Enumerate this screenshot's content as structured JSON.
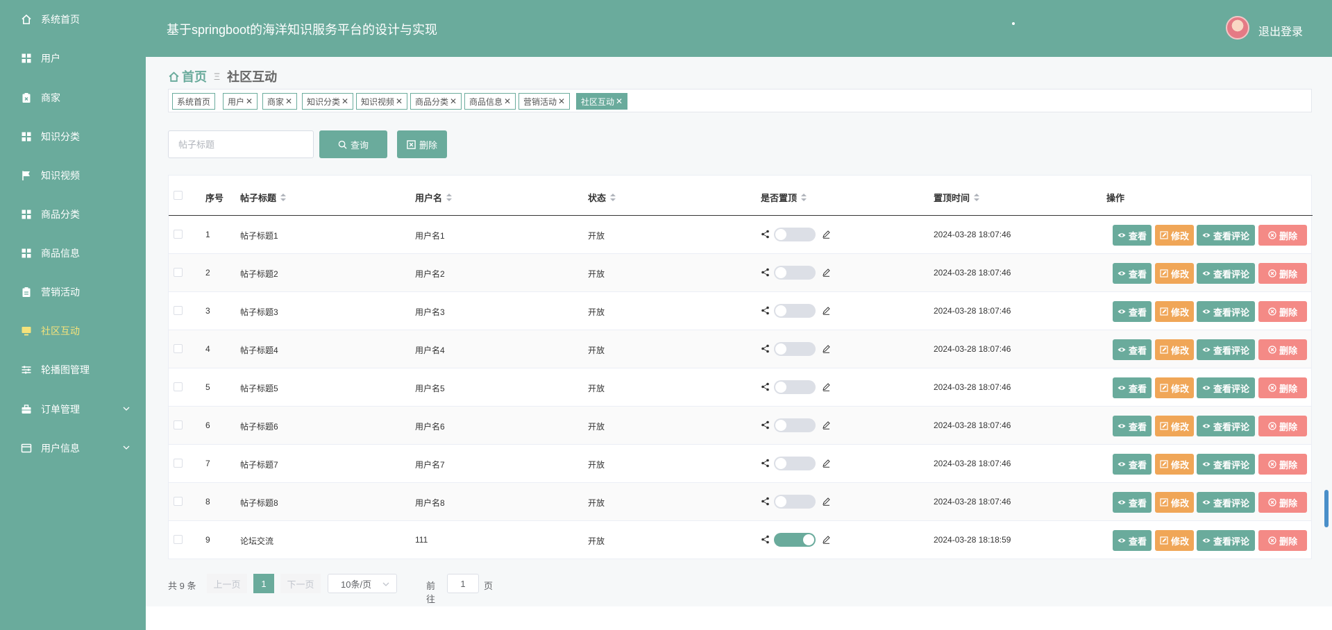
{
  "sidebar": {
    "items": [
      {
        "label": "系统首页",
        "icon": "home-icon",
        "active": false
      },
      {
        "label": "用户",
        "icon": "grid-icon",
        "active": false
      },
      {
        "label": "商家",
        "icon": "clipboard-x-icon",
        "active": false
      },
      {
        "label": "知识分类",
        "icon": "grid-icon",
        "active": false
      },
      {
        "label": "知识视频",
        "icon": "flag-icon",
        "active": false
      },
      {
        "label": "商品分类",
        "icon": "grid-icon",
        "active": false
      },
      {
        "label": "商品信息",
        "icon": "grid-icon",
        "active": false
      },
      {
        "label": "营销活动",
        "icon": "clipboard-icon",
        "active": false
      },
      {
        "label": "社区互动",
        "icon": "monitor-icon",
        "active": true
      },
      {
        "label": "轮播图管理",
        "icon": "sliders-icon",
        "active": false
      },
      {
        "label": "订单管理",
        "icon": "briefcase-icon",
        "active": false,
        "expandable": true
      },
      {
        "label": "用户信息",
        "icon": "card-icon",
        "active": false,
        "expandable": true
      }
    ]
  },
  "header": {
    "title": "基于springboot的海洋知识服务平台的设计与实现",
    "logout_label": "退出登录"
  },
  "breadcrumb": {
    "home": "首页",
    "separator": "Ξ",
    "current": "社区互动"
  },
  "tags": [
    {
      "label": "系统首页",
      "closable": false,
      "active": false
    },
    {
      "label": "用户",
      "closable": true,
      "active": false
    },
    {
      "label": "商家",
      "closable": true,
      "active": false
    },
    {
      "label": "知识分类",
      "closable": true,
      "active": false
    },
    {
      "label": "知识视频",
      "closable": true,
      "active": false
    },
    {
      "label": "商品分类",
      "closable": true,
      "active": false
    },
    {
      "label": "商品信息",
      "closable": true,
      "active": false
    },
    {
      "label": "营销活动",
      "closable": true,
      "active": false
    },
    {
      "label": "社区互动",
      "closable": true,
      "active": true
    }
  ],
  "tag_close_glyph": "✕",
  "search": {
    "placeholder": "帖子标题",
    "query_label": "查询",
    "delete_label": "删除"
  },
  "table": {
    "columns": {
      "index": "序号",
      "title": "帖子标题",
      "username": "用户名",
      "status": "状态",
      "pinned": "是否置顶",
      "pin_time": "置顶时间",
      "actions": "操作"
    },
    "rows": [
      {
        "index": "1",
        "title": "帖子标题1",
        "username": "用户名1",
        "status": "开放",
        "pinned": false,
        "pin_time": "2024-03-28 18:07:46"
      },
      {
        "index": "2",
        "title": "帖子标题2",
        "username": "用户名2",
        "status": "开放",
        "pinned": false,
        "pin_time": "2024-03-28 18:07:46"
      },
      {
        "index": "3",
        "title": "帖子标题3",
        "username": "用户名3",
        "status": "开放",
        "pinned": false,
        "pin_time": "2024-03-28 18:07:46"
      },
      {
        "index": "4",
        "title": "帖子标题4",
        "username": "用户名4",
        "status": "开放",
        "pinned": false,
        "pin_time": "2024-03-28 18:07:46"
      },
      {
        "index": "5",
        "title": "帖子标题5",
        "username": "用户名5",
        "status": "开放",
        "pinned": false,
        "pin_time": "2024-03-28 18:07:46"
      },
      {
        "index": "6",
        "title": "帖子标题6",
        "username": "用户名6",
        "status": "开放",
        "pinned": false,
        "pin_time": "2024-03-28 18:07:46"
      },
      {
        "index": "7",
        "title": "帖子标题7",
        "username": "用户名7",
        "status": "开放",
        "pinned": false,
        "pin_time": "2024-03-28 18:07:46"
      },
      {
        "index": "8",
        "title": "帖子标题8",
        "username": "用户名8",
        "status": "开放",
        "pinned": false,
        "pin_time": "2024-03-28 18:07:46"
      },
      {
        "index": "9",
        "title": "论坛交流",
        "username": "111",
        "status": "开放",
        "pinned": true,
        "pin_time": "2024-03-28 18:18:59"
      }
    ],
    "action_labels": {
      "view": "查看",
      "edit": "修改",
      "comments": "查看评论",
      "delete": "删除"
    }
  },
  "pagination": {
    "total_text": "共 9 条",
    "prev_label": "上一页",
    "current_page": "1",
    "next_label": "下一页",
    "page_size": "10条/页",
    "goto_label": "前往",
    "goto_value": "1",
    "page_suffix": "页"
  },
  "colors": {
    "primary": "#6aab9c",
    "warning": "#f0a657",
    "danger": "#f48a86",
    "active_nav": "#f5e27a"
  }
}
